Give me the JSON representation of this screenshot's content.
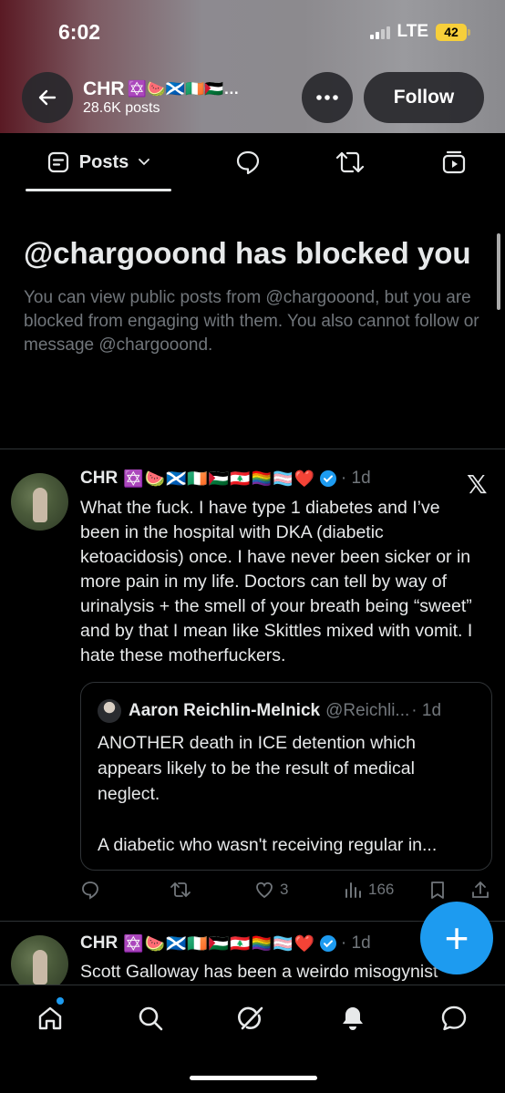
{
  "status": {
    "time": "6:02",
    "network": "LTE",
    "battery": "42"
  },
  "header": {
    "name": "CHR",
    "name_emojis": "✡️🍉🏴󠁧󠁢󠁳󠁣󠁴󠁿🇮🇪🇵🇸…",
    "posts_count": "28.6K posts",
    "follow_label": "Follow"
  },
  "tabs": {
    "posts_label": "Posts"
  },
  "blocked": {
    "title": "@chargooond has blocked you",
    "message": "You can view public posts from @chargooond, but you are blocked from engaging with them. You also cannot follow or message @chargooond."
  },
  "tweet1": {
    "name": "CHR",
    "emojis": "✡️🍉🏴󠁧󠁢󠁳󠁣󠁴󠁿🇮🇪🇵🇸🇱🇧🏳️‍🌈🏳️‍⚧️❤️",
    "age": "· 1d",
    "text": "What the fuck. I have type 1 diabetes and I’ve been in the hospital with DKA (diabetic ketoacidosis) once. I have never been sicker or in more pain in my life. Doctors can tell by way of urinalysis + the smell of your breath being “sweet” and by that I mean like Skittles mixed with vomit. I hate these motherfuckers.",
    "quote": {
      "name": "Aaron Reichlin-Melnick",
      "handle": "@Reichli...",
      "age": "· 1d",
      "text": "ANOTHER death in ICE detention which appears likely to be the result of medical neglect.\n\nA diabetic who wasn't receiving regular in..."
    },
    "likes": "3",
    "views": "166"
  },
  "tweet2": {
    "name": "CHR",
    "emojis": "✡️🍉🏴󠁧󠁢󠁳󠁣󠁴󠁿🇮🇪🇵🇸🇱🇧🏳️‍🌈🏳️‍⚧️❤️",
    "age": "· 1d",
    "text": "Scott Galloway has been a weirdo misogynist"
  },
  "icons": {
    "back": "back-arrow-icon",
    "more": "more-icon",
    "posts": "posts-icon",
    "replies": "reply-icon",
    "reposts": "repost-icon",
    "media": "media-icon",
    "verified": "verified-badge-icon",
    "x_logo": "x-logo-icon",
    "compose": "plus-icon",
    "home": "home-icon",
    "search": "search-icon",
    "grok": "grok-icon",
    "notifications": "bell-icon",
    "messages": "message-icon"
  },
  "colors": {
    "accent": "#1d9bf0",
    "muted": "#71767b",
    "text": "#e7e9ea",
    "battery": "#f7cf3a"
  }
}
